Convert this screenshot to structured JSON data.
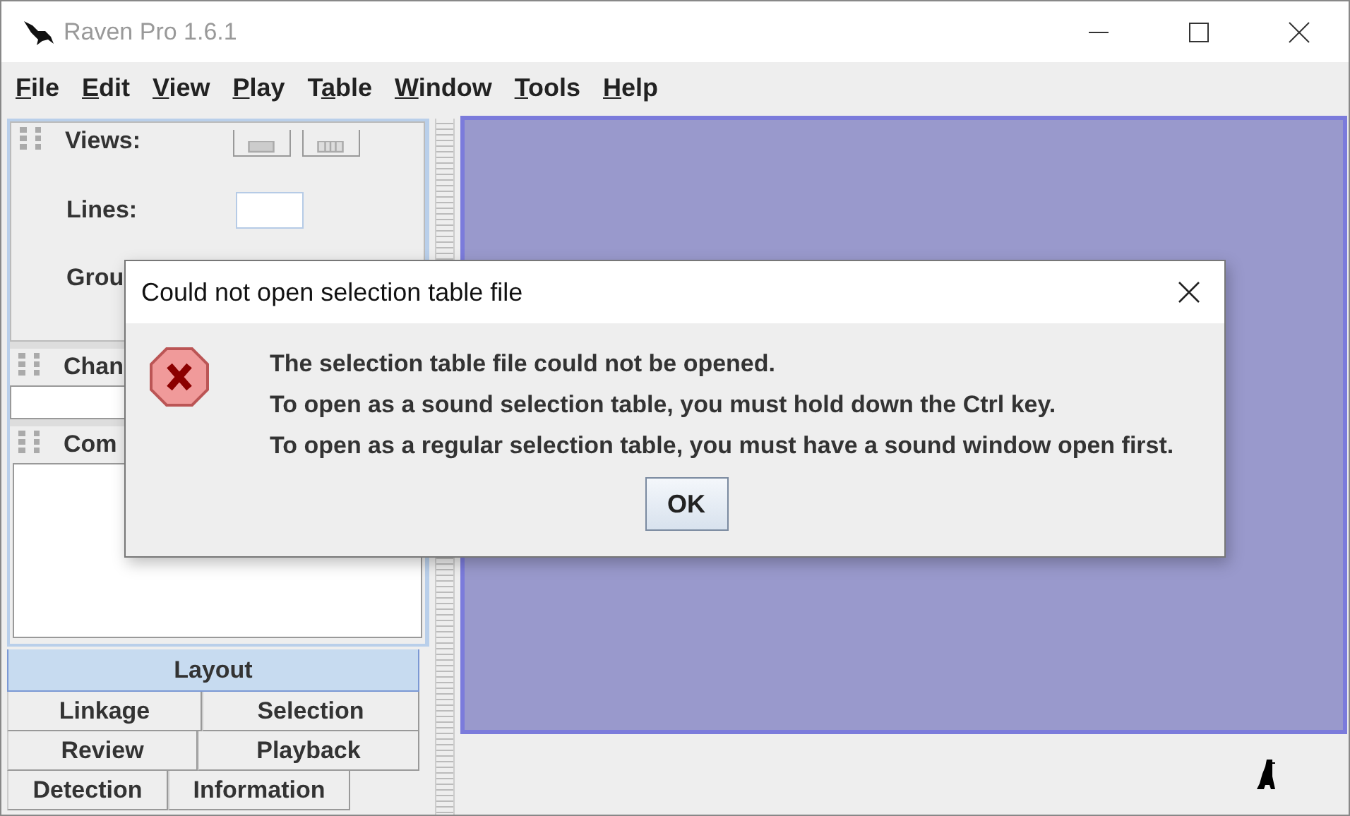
{
  "window": {
    "title": "Raven Pro 1.6.1"
  },
  "menu": [
    {
      "key": "F",
      "after": "ile"
    },
    {
      "key": "E",
      "after": "dit"
    },
    {
      "key": "V",
      "after": "iew"
    },
    {
      "key": "P",
      "after": "lay"
    },
    {
      "before": "T",
      "key": "a",
      "after": "ble"
    },
    {
      "key": "W",
      "after": "indow"
    },
    {
      "key": "T",
      "after": "ools"
    },
    {
      "key": "H",
      "after": "elp"
    }
  ],
  "views_panel": {
    "title": "Views:",
    "lines_label": "Lines:",
    "group_label": "Grou"
  },
  "sections": [
    {
      "title": "Chan",
      "kind": "field"
    },
    {
      "title": "Com",
      "kind": "list"
    }
  ],
  "tabs": [
    [
      {
        "label": "Layout",
        "selected": true
      }
    ],
    [
      {
        "label": "Linkage",
        "selected": false
      },
      {
        "label": "Selection",
        "selected": false
      }
    ],
    [
      {
        "label": "Review",
        "selected": false
      },
      {
        "label": "Playback",
        "selected": false
      }
    ],
    [
      {
        "label": "Detection",
        "selected": false
      },
      {
        "label": "Information",
        "selected": false
      }
    ]
  ],
  "dialog": {
    "title": "Could not open selection table file",
    "lines": [
      "The selection table file could not be opened.",
      "To open as a sound selection table, you must hold down the Ctrl key.",
      "To open as a regular selection table, you must have a sound window open first."
    ],
    "button": "OK"
  }
}
